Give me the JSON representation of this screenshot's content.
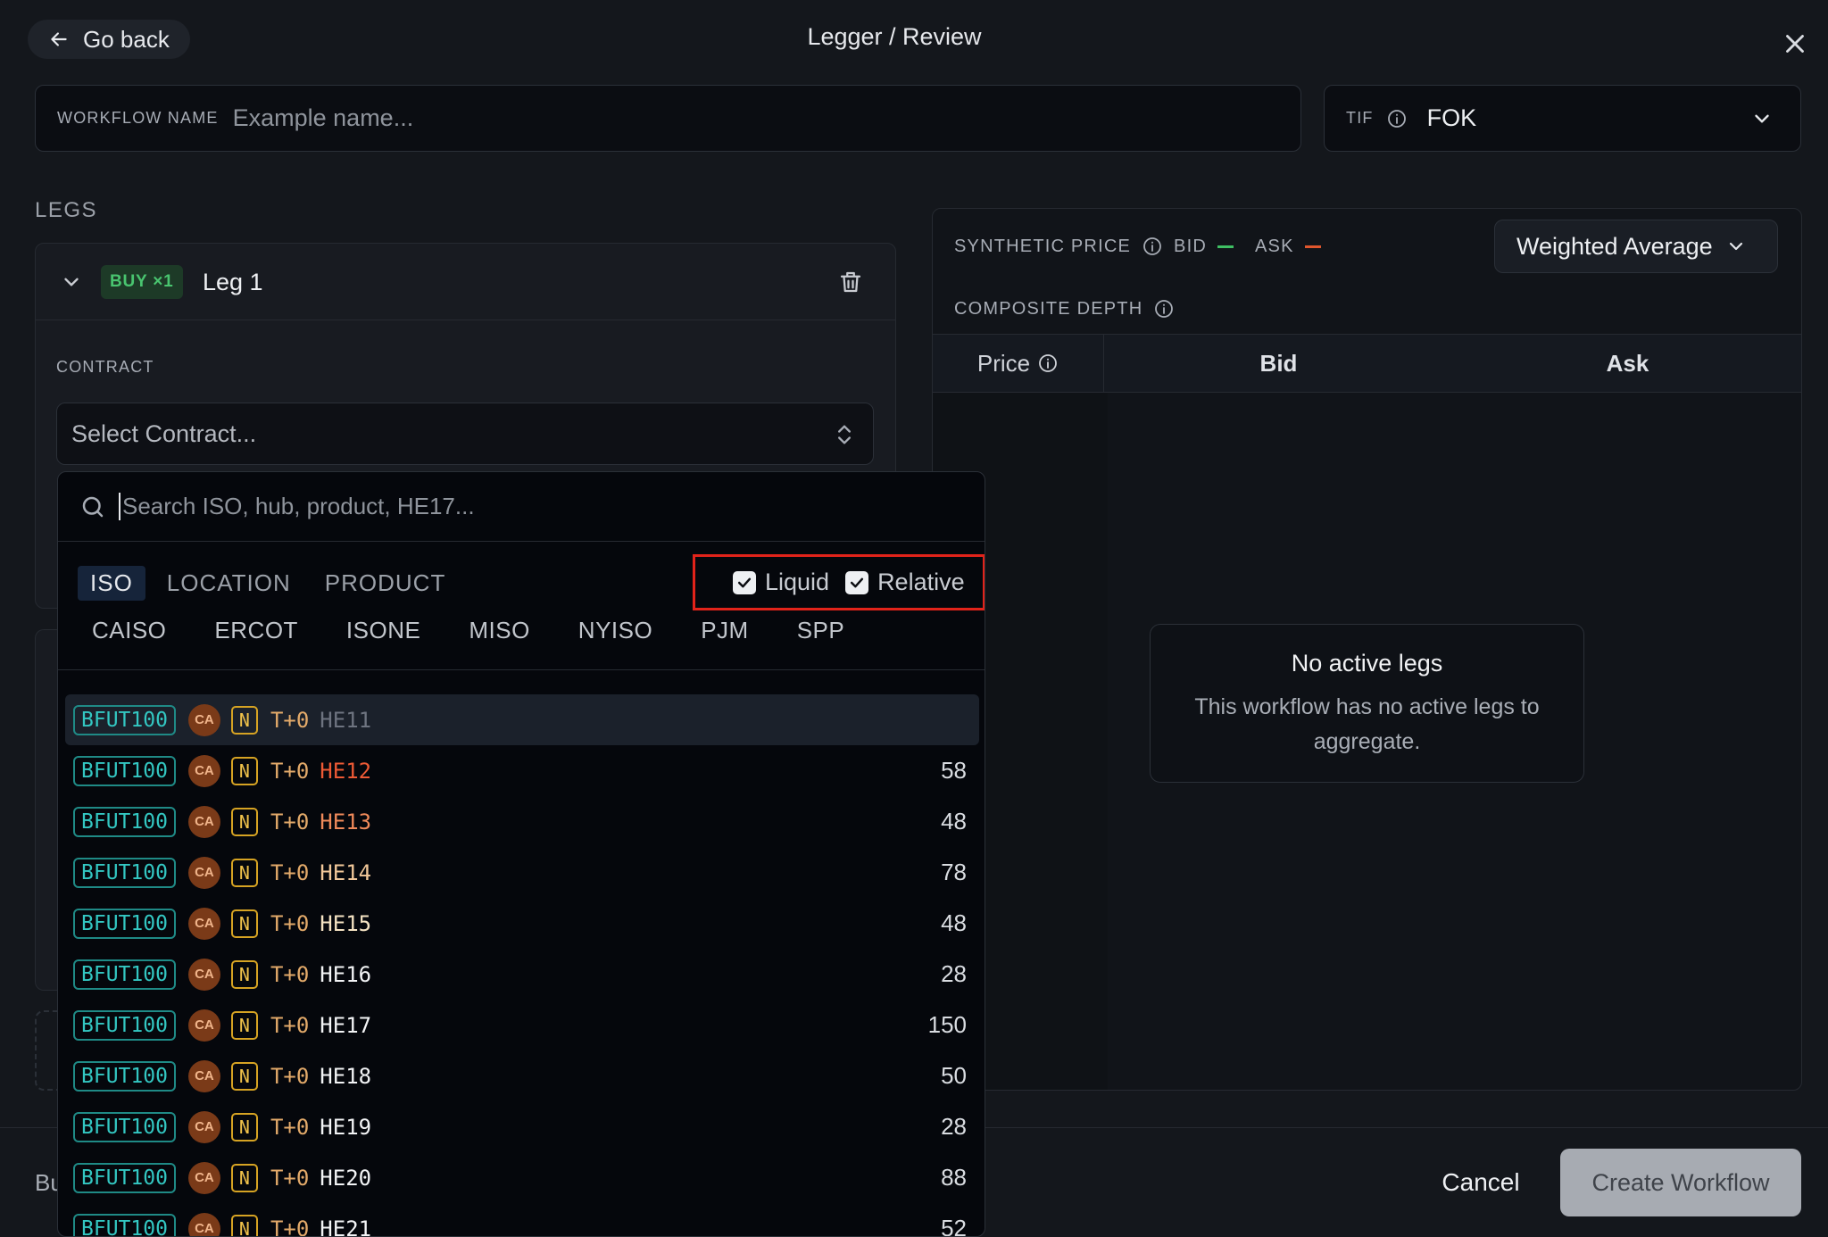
{
  "header": {
    "back_label": "Go back",
    "title": "Legger / Review"
  },
  "workflow": {
    "name_label": "WORKFLOW NAME",
    "name_placeholder": "Example name..."
  },
  "tif": {
    "label": "TIF",
    "value": "FOK"
  },
  "legs": {
    "heading": "LEGS",
    "leg1": {
      "side_badge": "BUY ×1",
      "name": "Leg 1",
      "contract_label": "CONTRACT",
      "contract_placeholder": "Select Contract..."
    }
  },
  "synthetic": {
    "label": "SYNTHETIC PRICE",
    "bid_label": "BID",
    "ask_label": "ASK",
    "method": "Weighted Average",
    "bid_color": "#3fbf63",
    "ask_color": "#e0562d"
  },
  "depth": {
    "label": "COMPOSITE DEPTH",
    "columns": [
      "Price",
      "Bid",
      "Ask"
    ],
    "empty_title": "No active legs",
    "empty_desc": "This workflow has no active legs to aggregate."
  },
  "picker": {
    "search_placeholder": "Search ISO, hub, product, HE17...",
    "tabs": [
      "ISO",
      "LOCATION",
      "PRODUCT"
    ],
    "active_tab": "ISO",
    "filters": [
      {
        "label": "Liquid",
        "checked": true
      },
      {
        "label": "Relative",
        "checked": true
      }
    ],
    "isos": [
      "CAISO",
      "ERCOT",
      "ISONE",
      "MISO",
      "NYISO",
      "PJM",
      "SPP"
    ],
    "rows": [
      {
        "sym": "BFUT100",
        "iso_badge": "CA",
        "type_badge": "N",
        "day": "T+0",
        "he": "HE11",
        "qty": "",
        "he_color": "#6e7480"
      },
      {
        "sym": "BFUT100",
        "iso_badge": "CA",
        "type_badge": "N",
        "day": "T+0",
        "he": "HE12",
        "qty": "58",
        "he_color": "#ee5a35"
      },
      {
        "sym": "BFUT100",
        "iso_badge": "CA",
        "type_badge": "N",
        "day": "T+0",
        "he": "HE13",
        "qty": "48",
        "he_color": "#f08a5a"
      },
      {
        "sym": "BFUT100",
        "iso_badge": "CA",
        "type_badge": "N",
        "day": "T+0",
        "he": "HE14",
        "qty": "78",
        "he_color": "#f2c89a"
      },
      {
        "sym": "BFUT100",
        "iso_badge": "CA",
        "type_badge": "N",
        "day": "T+0",
        "he": "HE15",
        "qty": "48",
        "he_color": "#f5e3c3"
      },
      {
        "sym": "BFUT100",
        "iso_badge": "CA",
        "type_badge": "N",
        "day": "T+0",
        "he": "HE16",
        "qty": "28",
        "he_color": "#f3f4f6"
      },
      {
        "sym": "BFUT100",
        "iso_badge": "CA",
        "type_badge": "N",
        "day": "T+0",
        "he": "HE17",
        "qty": "150",
        "he_color": "#f3f4f6"
      },
      {
        "sym": "BFUT100",
        "iso_badge": "CA",
        "type_badge": "N",
        "day": "T+0",
        "he": "HE18",
        "qty": "50",
        "he_color": "#f3f4f6"
      },
      {
        "sym": "BFUT100",
        "iso_badge": "CA",
        "type_badge": "N",
        "day": "T+0",
        "he": "HE19",
        "qty": "28",
        "he_color": "#f3f4f6"
      },
      {
        "sym": "BFUT100",
        "iso_badge": "CA",
        "type_badge": "N",
        "day": "T+0",
        "he": "HE20",
        "qty": "88",
        "he_color": "#f3f4f6"
      },
      {
        "sym": "BFUT100",
        "iso_badge": "CA",
        "type_badge": "N",
        "day": "T+0",
        "he": "HE21",
        "qty": "52",
        "he_color": "#f3f4f6"
      }
    ]
  },
  "footer": {
    "left_text": "Bu",
    "cancel_label": "Cancel",
    "create_label": "Create Workflow"
  }
}
